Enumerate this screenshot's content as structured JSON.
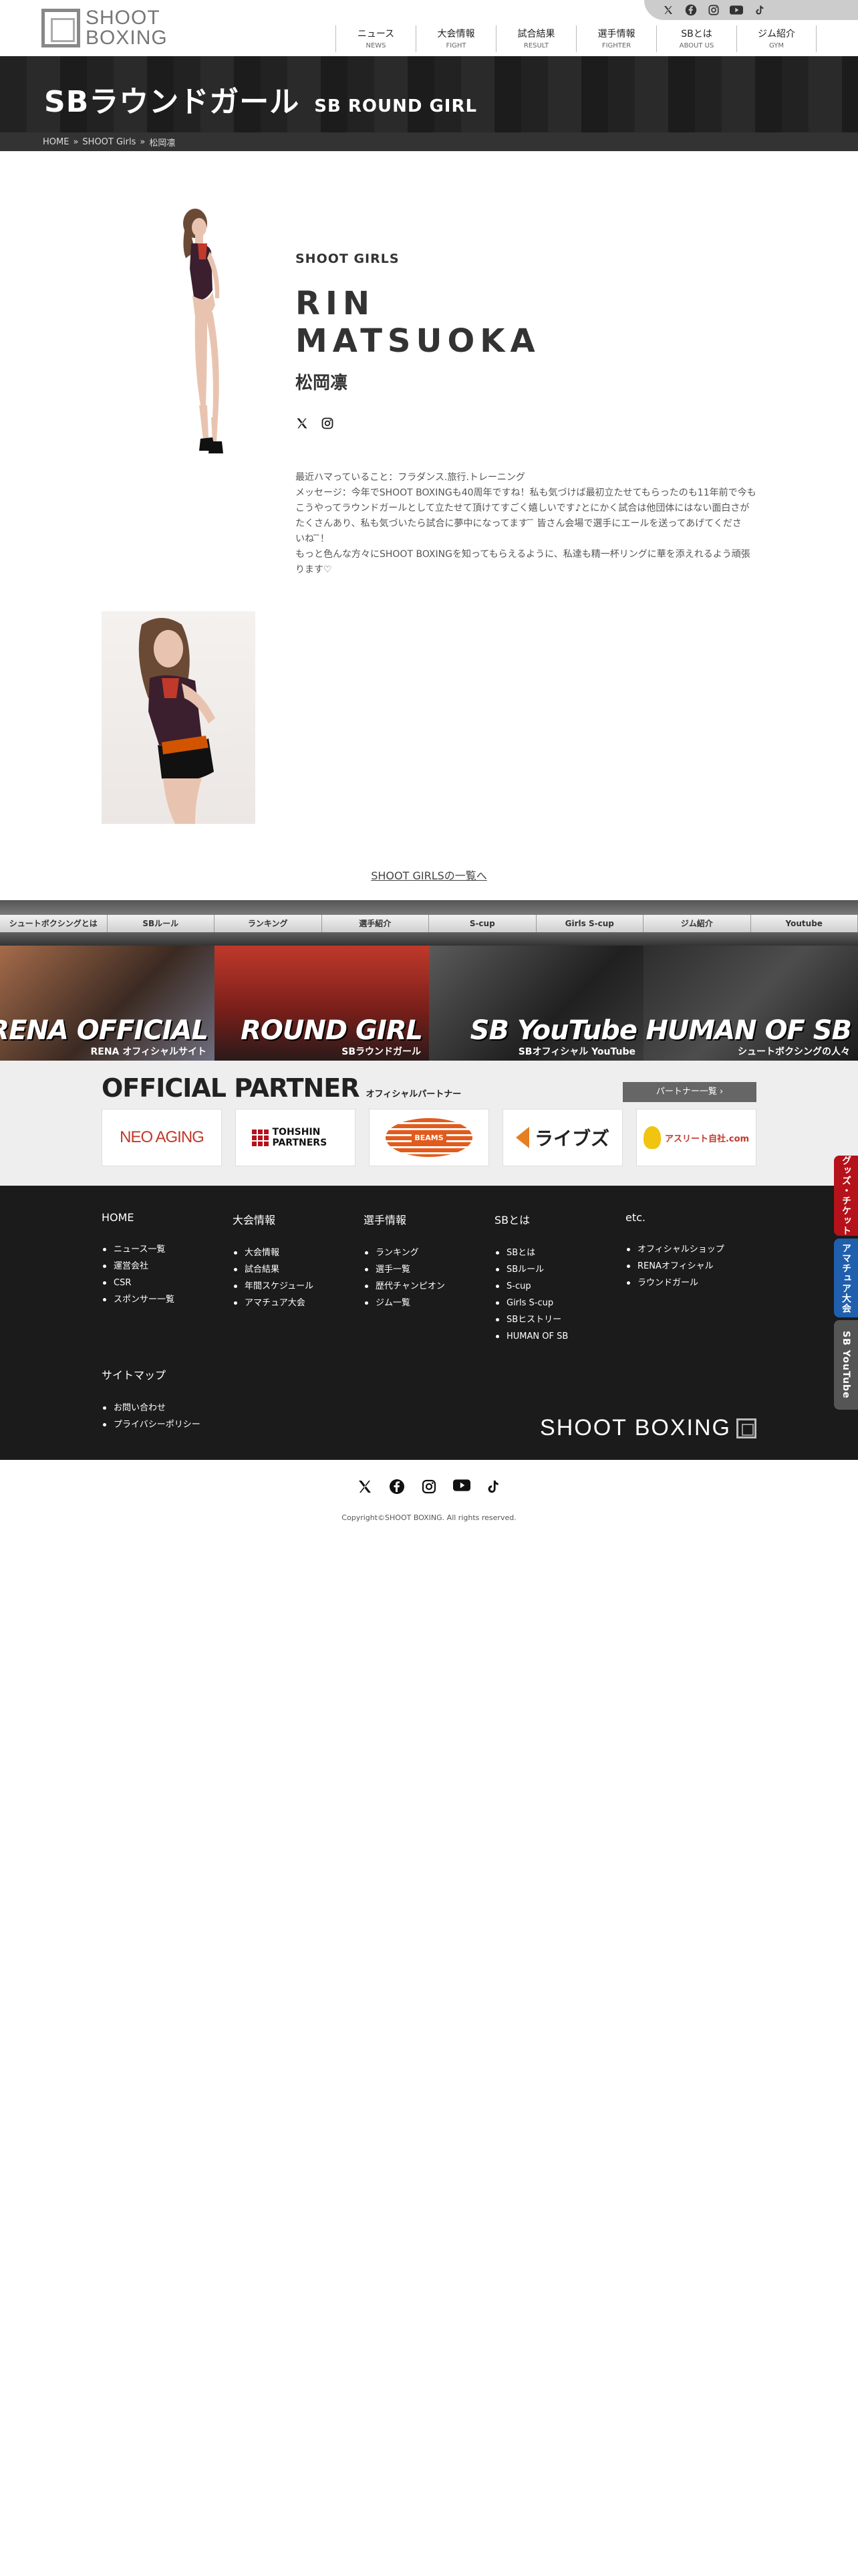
{
  "header": {
    "logo_line1": "SHOOT",
    "logo_line2": "BOXING",
    "nav": [
      {
        "jp": "ニュース",
        "en": "NEWS"
      },
      {
        "jp": "大会情報",
        "en": "FIGHT"
      },
      {
        "jp": "試合結果",
        "en": "RESULT"
      },
      {
        "jp": "選手情報",
        "en": "FIGHTER"
      },
      {
        "jp": "SBとは",
        "en": "ABOUT US"
      },
      {
        "jp": "ジム紹介",
        "en": "GYM"
      }
    ],
    "social_icons": [
      "x-icon",
      "facebook-icon",
      "instagram-icon",
      "youtube-icon",
      "tiktok-icon"
    ]
  },
  "hero": {
    "title_jp": "SBラウンドガール",
    "title_en": "SB ROUND GIRL",
    "breadcrumb": [
      "HOME",
      "SHOOT Girls",
      "松岡凛"
    ],
    "separator": "»"
  },
  "profile": {
    "team": "SHOOT GIRLS",
    "name_en_line1": "RIN",
    "name_en_line2": "MATSUOKA",
    "name_jp": "松岡凛",
    "bio": [
      "最近ハマっていること：フラダンス.旅行.トレーニング",
      "メッセージ：今年でSHOOT BOXINGも40周年ですね！私も気づけば最初立たせてもらったのも11年前で今も",
      "こうやってラウンドガールとして立たせて頂けてすごく嬉しいです♪とにかく試合は他団体にはない面白さが",
      "たくさんあり、私も気づいたら試合に夢中になってます ̄  ̄ 皆さん会場で選手にエールを送ってあげてくださ",
      "いね ̄ ̄！",
      "もっと色んな方々にSHOOT BOXINGを知ってもらえるように、私達も精一杯リングに華を添えれるよう頑張",
      "ります♡"
    ],
    "list_link": "SHOOT GIRLSの一覧へ"
  },
  "banner": {
    "categories": [
      "シュートボクシングとは",
      "SBルール",
      "ランキング",
      "選手紹介",
      "S-cup",
      "Girls S-cup",
      "ジム紹介",
      "Youtube"
    ],
    "tiles": [
      {
        "big": "RENA OFFICIAL",
        "small": "RENA オフィシャルサイト"
      },
      {
        "big": "ROUND GIRL",
        "small": "SBラウンドガール"
      },
      {
        "big": "SB YouTube",
        "small": "SBオフィシャル YouTube"
      },
      {
        "big": "HUMAN OF SB",
        "small": "シュートボクシングの人々"
      }
    ]
  },
  "partners": {
    "title_en": "OFFICIAL PARTNER",
    "title_jp": "オフィシャルパートナー",
    "more": "パートナー一覧 ›",
    "logos": [
      "NEO AGING",
      "TOHSHIN PARTNERS",
      "BEAMS",
      "ライブズ",
      "アスリート自社.com"
    ]
  },
  "footer": {
    "columns": [
      {
        "title": "HOME",
        "items": [
          "ニュース一覧",
          "運営会社",
          "CSR",
          "スポンサー一覧"
        ]
      },
      {
        "title": "大会情報",
        "items": [
          "大会情報",
          "試合結果",
          "年間スケジュール",
          "アマチュア大会"
        ]
      },
      {
        "title": "選手情報",
        "items": [
          "ランキング",
          "選手一覧",
          "歴代チャンピオン",
          "ジム一覧"
        ]
      },
      {
        "title": "SBとは",
        "items": [
          "SBとは",
          "SBルール",
          "S-cup",
          "Girls S-cup",
          "SBヒストリー",
          "HUMAN OF SB"
        ]
      },
      {
        "title": "etc.",
        "items": [
          "オフィシャルショップ",
          "RENAオフィシャル",
          "ラウンドガール"
        ]
      }
    ],
    "sitemap": {
      "title": "サイトマップ",
      "items": [
        "お問い合わせ",
        "プライバシーポリシー"
      ]
    },
    "logo": "SHOOT BOXING"
  },
  "bottom": {
    "copyright": "Copyright©SHOOT BOXING. All rights reserved."
  },
  "side_tabs": [
    {
      "label": "グッズ・チケット",
      "color": "#b5121b"
    },
    {
      "label": "アマチュア大会",
      "color": "#1f5fae"
    },
    {
      "label": "SB YouTube",
      "color": "#555555"
    }
  ]
}
